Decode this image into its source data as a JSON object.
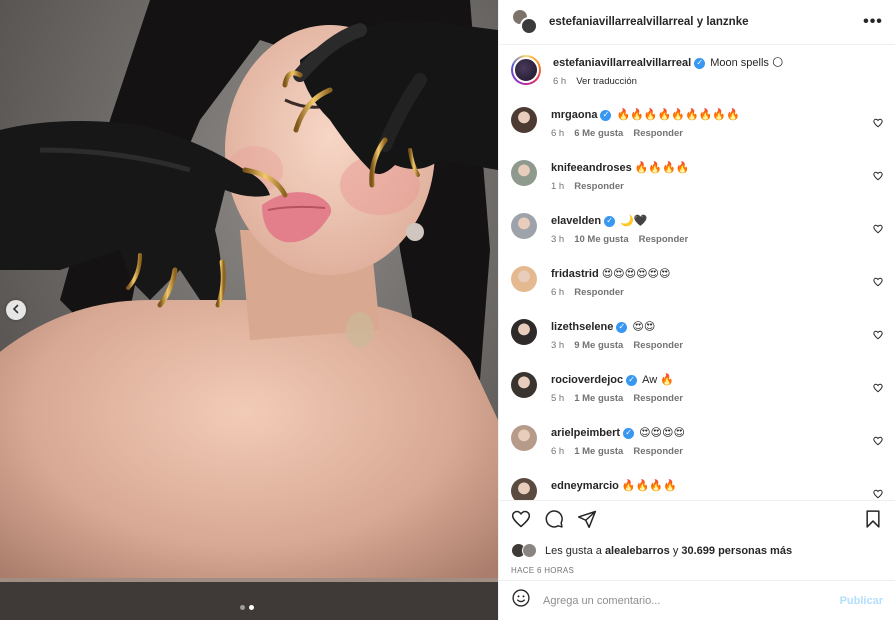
{
  "colors": {
    "accent": "#0095f6",
    "verified": "#3897f0",
    "muted": "#737373",
    "publish_disabled": "#b2dffc"
  },
  "post": {
    "header_user": "estefaniavillarrealvillarreal",
    "header_connector": "y",
    "header_collab": "lanznke",
    "carousel": {
      "current": 2,
      "total": 2
    }
  },
  "caption": {
    "username": "estefaniavillarrealvillarreal",
    "text": "Moon spells 🌕",
    "time": "6 h",
    "translate": "Ver traducción"
  },
  "comments": [
    {
      "username": "mrgaona",
      "verified": true,
      "text": "🔥🔥🔥🔥🔥🔥🔥🔥🔥",
      "time": "6 h",
      "likes": "6 Me gusta",
      "reply": "Responder",
      "avatar": "#4b3b33"
    },
    {
      "username": "knifeeandroses",
      "verified": false,
      "text": "🔥🔥🔥🔥",
      "time": "1 h",
      "likes": "",
      "reply": "Responder",
      "avatar": "#8d9a8d"
    },
    {
      "username": "elavelden",
      "verified": true,
      "text": "🌙🖤",
      "time": "3 h",
      "likes": "10 Me gusta",
      "reply": "Responder",
      "avatar": "#9ea3ab"
    },
    {
      "username": "fridastrid",
      "verified": false,
      "text": "😍😍😍😍😍😍",
      "time": "6 h",
      "likes": "",
      "reply": "Responder",
      "avatar": "#e4b98f"
    },
    {
      "username": "lizethselene",
      "verified": true,
      "text": "😍😍",
      "time": "3 h",
      "likes": "9 Me gusta",
      "reply": "Responder",
      "avatar": "#2f2a2a"
    },
    {
      "username": "rocioverdejoc",
      "verified": true,
      "text": "Aw 🔥",
      "time": "5 h",
      "likes": "1 Me gusta",
      "reply": "Responder",
      "avatar": "#3a3431"
    },
    {
      "username": "arielpeimbert",
      "verified": true,
      "text": "😍😍😍😍",
      "time": "6 h",
      "likes": "1 Me gusta",
      "reply": "Responder",
      "avatar": "#b69a8a"
    },
    {
      "username": "edneymarcio",
      "verified": false,
      "text": "🔥🔥🔥🔥",
      "time": "",
      "likes": "",
      "reply": "",
      "avatar": "#5a4a40"
    }
  ],
  "likes": {
    "prefix": "Les gusta a",
    "user": "alealebarros",
    "connector": "y",
    "others": "30.699 personas más"
  },
  "timestamp": "HACE 6 HORAS",
  "add_comment": {
    "placeholder": "Agrega un comentario...",
    "publish": "Publicar"
  },
  "icons": {
    "like": "heart-icon",
    "comment": "comment-icon",
    "share": "send-icon",
    "save": "bookmark-icon",
    "emoji": "emoji-icon",
    "more": "more-icon",
    "prev": "chevron-left-icon"
  }
}
